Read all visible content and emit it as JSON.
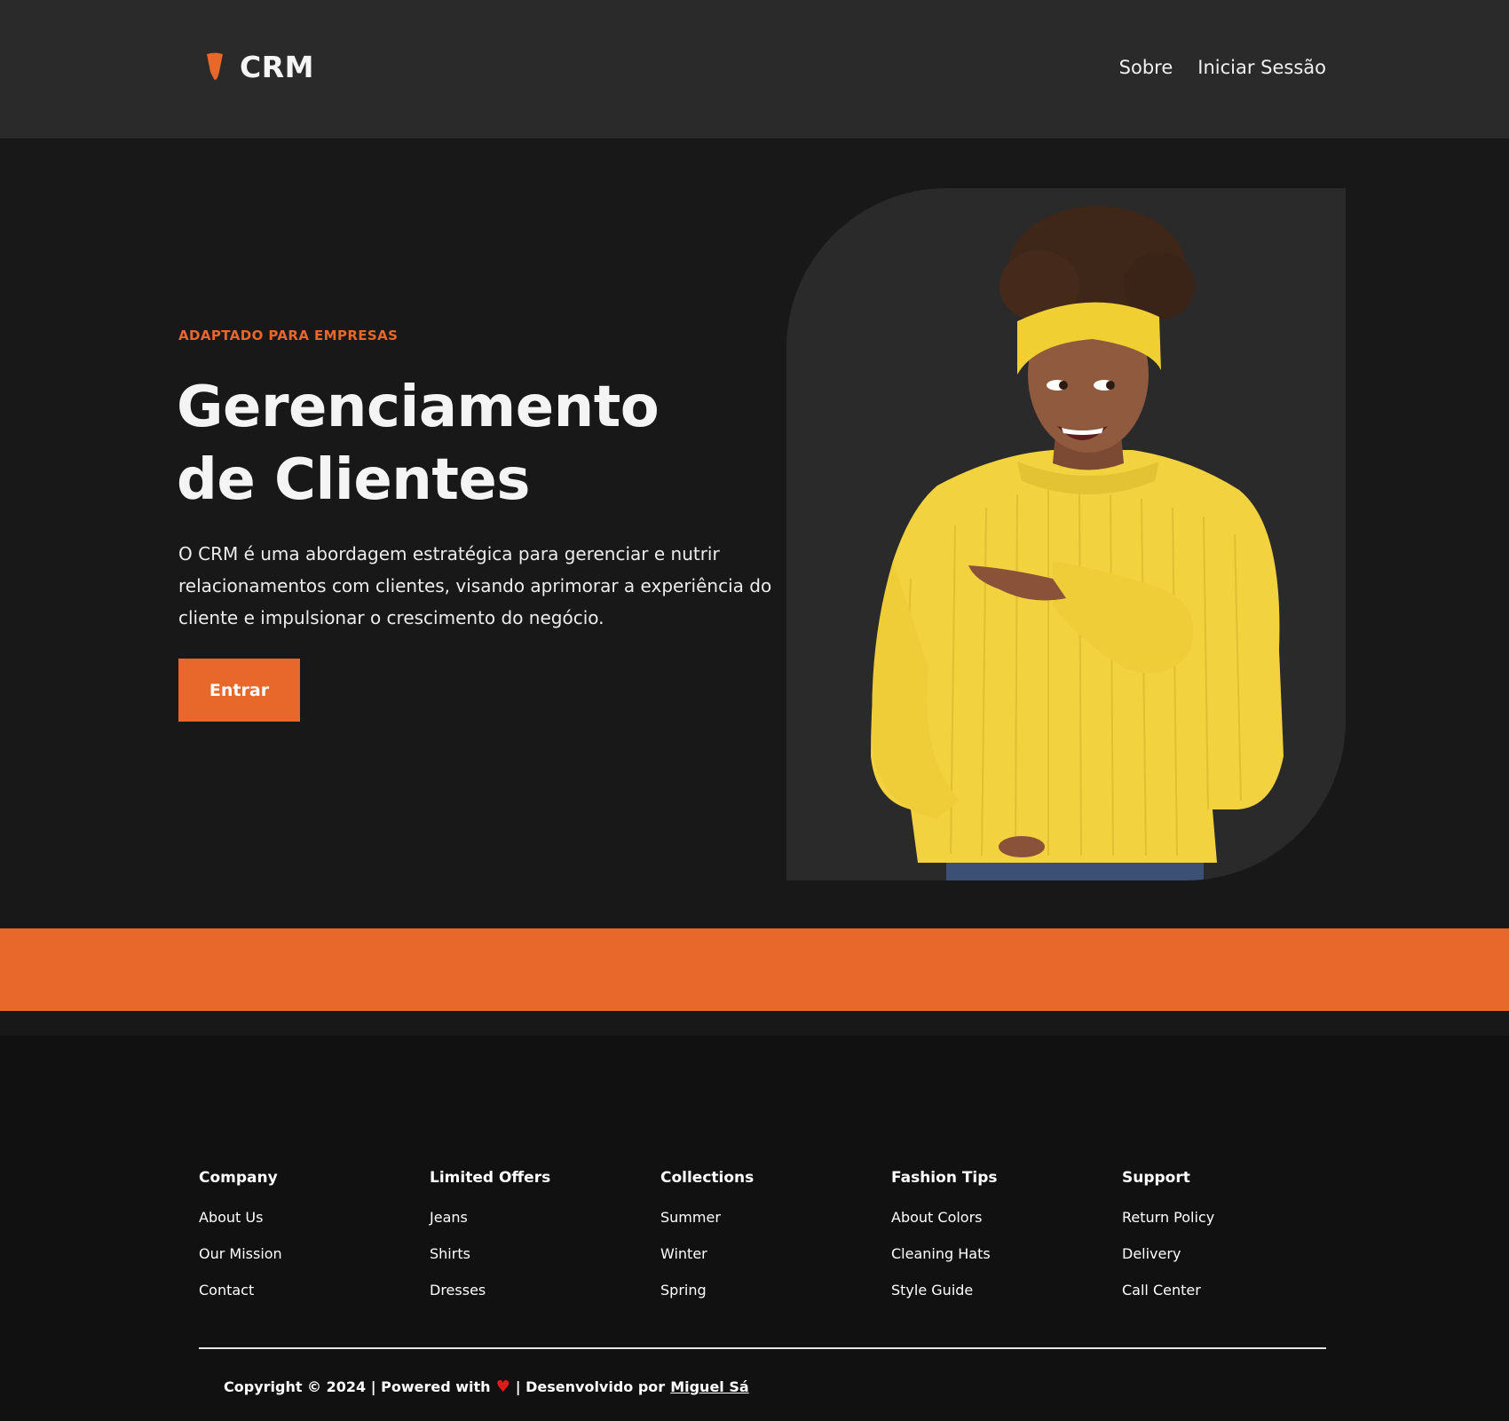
{
  "header": {
    "logo_text": "CRM",
    "nav": [
      "Sobre",
      "Iniciar Sessão"
    ]
  },
  "hero": {
    "eyebrow": "ADAPTADO PARA EMPRESAS",
    "title_line1": "Gerenciamento",
    "title_line2": "de Clientes",
    "description": "O CRM é uma abordagem estratégica para gerenciar e nutrir relacionamentos com clientes, visando aprimorar a experiência do cliente e impulsionar o crescimento do negócio.",
    "cta_label": "Entrar"
  },
  "footer": {
    "columns": [
      {
        "heading": "Company",
        "links": [
          "About Us",
          "Our Mission",
          "Contact"
        ]
      },
      {
        "heading": "Limited Offers",
        "links": [
          "Jeans",
          "Shirts",
          "Dresses"
        ]
      },
      {
        "heading": "Collections",
        "links": [
          "Summer",
          "Winter",
          "Spring"
        ]
      },
      {
        "heading": "Fashion Tips",
        "links": [
          "About Colors",
          "Cleaning Hats",
          "Style Guide"
        ]
      },
      {
        "heading": "Support",
        "links": [
          "Return Policy",
          "Delivery",
          "Call Center"
        ]
      }
    ],
    "copyright_prefix": "Copyright © 2024 | Powered with",
    "copyright_middle": "| Desenvolvido por",
    "author": "Miguel Sá"
  },
  "colors": {
    "accent": "#e8672a",
    "header_bg": "#2a2a2b",
    "hero_bg": "#181819",
    "footer_bg": "#111111",
    "heart": "#e01b1b"
  },
  "icons": {
    "logo": "carrot-drop-icon",
    "heart": "heart-icon"
  }
}
